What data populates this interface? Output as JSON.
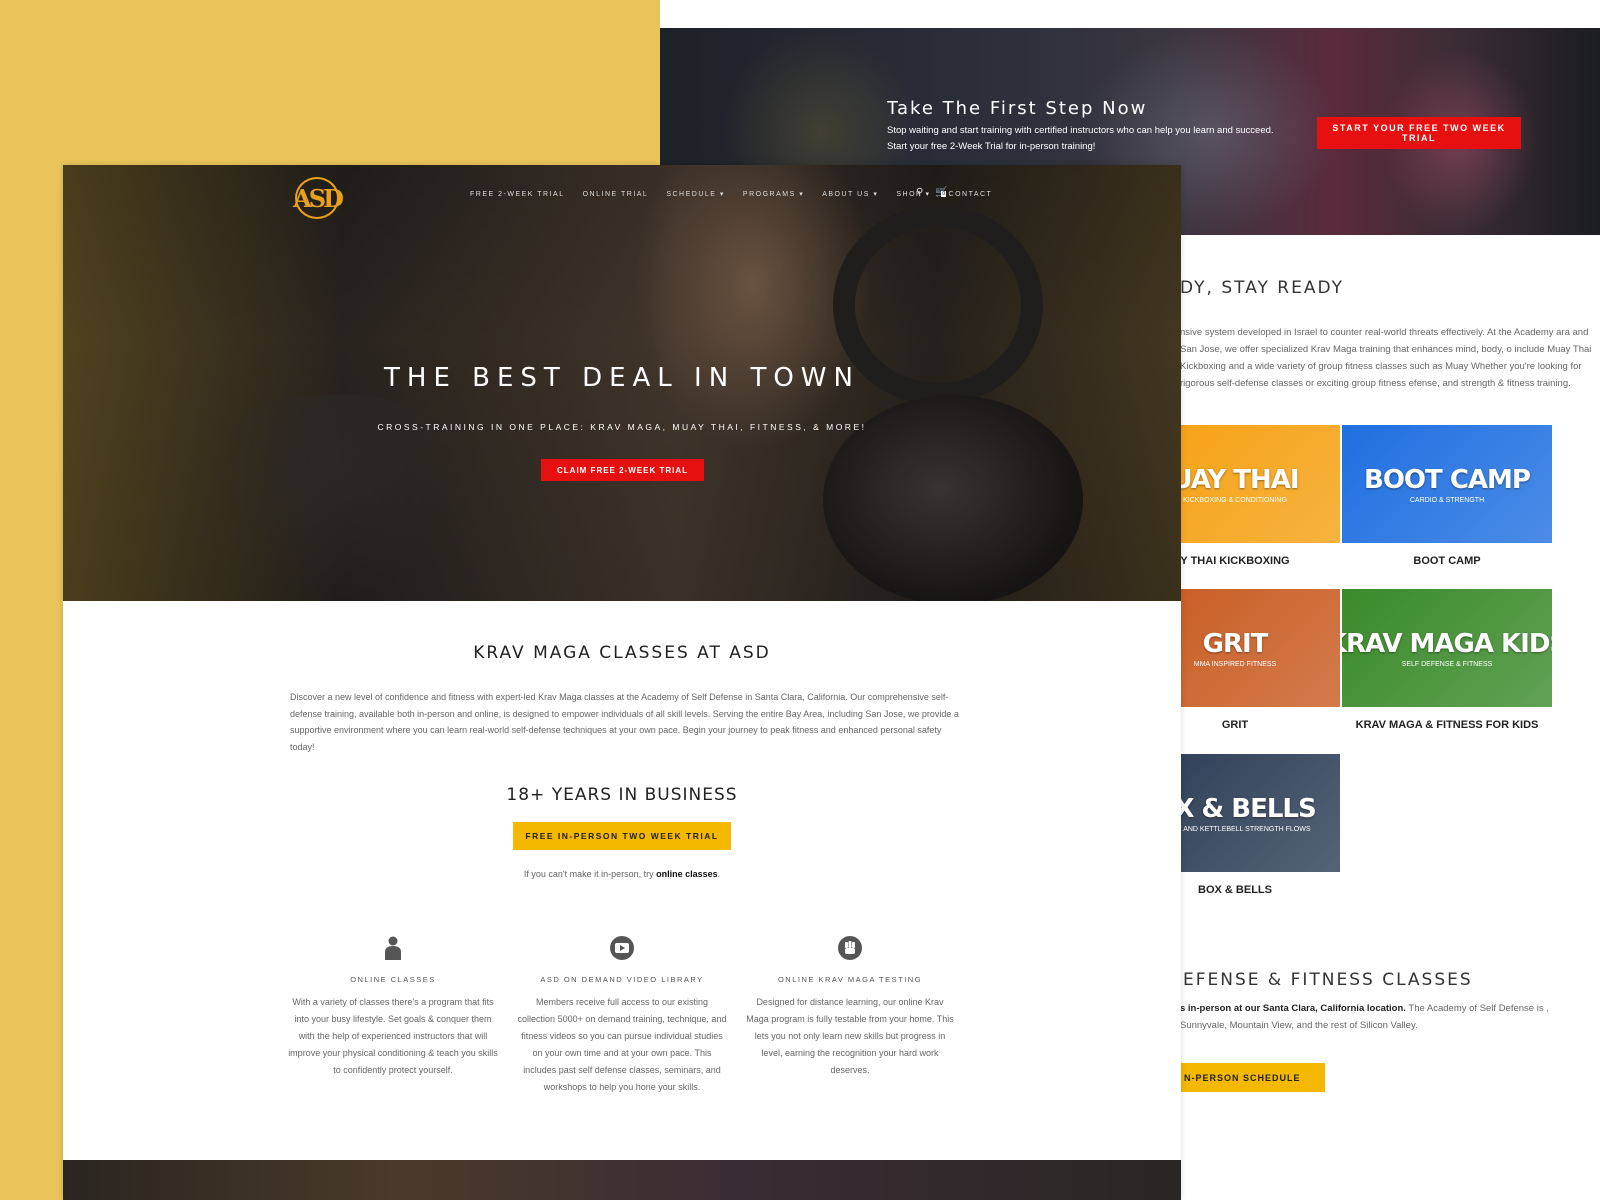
{
  "back": {
    "cta_title": "Take The First Step Now",
    "cta_text_1": "Stop waiting and start training with certified instructors who can help you learn and succeed.",
    "cta_text_2": "Start your free 2-Week Trial for in-person training!",
    "cta_button": "START YOUR FREE TWO WEEK TRIAL",
    "ready_title": "DY, STAY READY",
    "ready_text": "nsive system developed in Israel to counter real-world threats effectively. At the Academy ara and San Jose, we offer specialized Krav Maga training that enhances mind, body, o include Muay Thai Kickboxing and a wide variety of group fitness classes such as Muay Whether you're looking for rigorous self-defense classes or exciting group fitness efense, and strength & fitness training.",
    "programs": [
      {
        "big": "UAY THAI",
        "small": "KICKBOXING & CONDITIONING",
        "caption": "Y THAI KICKBOXING",
        "color": "#f5a010"
      },
      {
        "big": "BOOT CAMP",
        "small": "CARDIO & STRENGTH",
        "caption": "BOOT CAMP",
        "color": "#1f6fe0"
      },
      {
        "big": "GRIT",
        "small": "MMA INSPIRED FITNESS",
        "caption": "GRIT",
        "color": "#c85a20"
      },
      {
        "big": "KRAV MAGA KIDS",
        "small": "SELF DEFENSE & FITNESS",
        "caption": "KRAV MAGA & FITNESS FOR KIDS",
        "color": "#3a8a2a"
      },
      {
        "big": "OX & BELLS",
        "small": "NIQUE AND KETTLEBELL STRENGTH FLOWS",
        "caption": "BOX & BELLS",
        "color": "#2a3c55"
      }
    ],
    "classes_title": "EFENSE & FITNESS CLASSES",
    "classes_text_bold": "s in-person at our Santa Clara, California location.",
    "classes_text": " The Academy of Self Defense is , Sunnyvale, Mountain View, and the rest of Silicon Valley.",
    "schedule_button": "N-PERSON SCHEDULE"
  },
  "front": {
    "logo_text": "ASD",
    "nav": [
      "FREE 2-WEEK TRIAL",
      "ONLINE TRIAL",
      "SCHEDULE ▾",
      "PROGRAMS ▾",
      "ABOUT US ▾",
      "SHOP ▾",
      "CONTACT"
    ],
    "cart_count": "0",
    "hero_title": "THE BEST DEAL IN TOWN",
    "hero_subtitle": "CROSS-TRAINING IN ONE PLACE: KRAV MAGA, MUAY THAI, FITNESS, & MORE!",
    "hero_button": "CLAIM FREE 2-WEEK TRIAL",
    "section_title": "KRAV MAGA CLASSES AT ASD",
    "intro": "Discover a new level of confidence and fitness with expert-led Krav Maga classes at the Academy of Self Defense in Santa Clara, California. Our comprehensive self-defense training, available both in-person and online, is designed to empower individuals of all skill levels. Serving the entire Bay Area, including San Jose, we provide a supportive environment where you can learn real-world self-defense techniques at your own pace. Begin your journey to peak fitness and enhanced personal safety today!",
    "years_title": "18+ YEARS IN BUSINESS",
    "trial_button": "FREE IN-PERSON TWO WEEK TRIAL",
    "online_note_pre": "If you can't make it in-person, try ",
    "online_note_link": "online classes",
    "online_note_post": ".",
    "features": [
      {
        "icon": "user-icon",
        "title": "ONLINE CLASSES",
        "text": "With a variety of classes there's a program that fits into your busy lifestyle. Set goals & conquer them with the help of experienced instructors that will improve your physical conditioning & teach you skills to confidently protect yourself."
      },
      {
        "icon": "video-play-icon",
        "title": "ASD ON DEMAND VIDEO LIBRARY",
        "text": "Members receive full access to our existing collection 5000+ on demand training, technique, and fitness videos so you can pursue individual studies on your own time and at your own pace. This includes past self defense classes, seminars, and workshops to help you hone your skills."
      },
      {
        "icon": "fist-icon",
        "title": "ONLINE KRAV MAGA TESTING",
        "text": "Designed for distance learning, our online Krav Maga program is fully testable from your home. This lets you not only learn new skills but progress in level, earning the recognition your hard work deserves."
      }
    ]
  }
}
